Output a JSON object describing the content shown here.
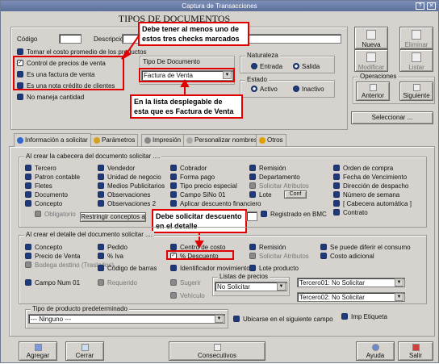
{
  "window": {
    "title": "Captura de Transacciones"
  },
  "header": {
    "doc_title": "TIPOS DE DOCUMENTOS"
  },
  "fields": {
    "codigo_label": "Código",
    "codigo_value": "",
    "descripcion_label": "Descripción",
    "descripcion_value": ""
  },
  "top_checks": [
    {
      "label": "Tomar el costo promedio de los productos",
      "checked": false
    },
    {
      "label": "Control de precios de venta",
      "checked": true
    },
    {
      "label": "Es una factura de venta",
      "checked": false
    },
    {
      "label": "Es una nota crédito de clientes",
      "checked": false
    },
    {
      "label": "No maneja cantidad",
      "checked": false
    }
  ],
  "tipo_documento": {
    "label": "Tipo De Documento",
    "selected": "Factura de Venta"
  },
  "naturaleza": {
    "label": "Naturaleza",
    "options": [
      "Entrada",
      "Salida"
    ],
    "selected": "Salida"
  },
  "estado": {
    "label": "Estado",
    "options": [
      "Activo",
      "Inactivo"
    ],
    "selected": "Activo"
  },
  "side_buttons": {
    "nueva": "Nueva",
    "eliminar": "Eliminar",
    "modificar": "Modificar",
    "listar": "Listar"
  },
  "operaciones": {
    "label": "Operaciones",
    "anterior": "Anterior",
    "siguiente": "Siguiente",
    "seleccionar": "Seleccionar ..."
  },
  "tabs": [
    "Información a solicitar",
    "Parámetros",
    "Impresión",
    "Personalizar nombres",
    "Otros"
  ],
  "cabecera": {
    "legend": "Al crear la cabecera del documento solicitar ....",
    "col1": [
      "Tercero",
      "Patron contable",
      "Fletes",
      "Documento",
      "Concepto"
    ],
    "col2": [
      "Vendedor",
      "Unidad de negocio",
      "Medios Publicitarios",
      "Observaciones",
      "Observaciones 2"
    ],
    "col3": [
      "Cobrador",
      "Forma pago",
      "Tipo precio especial",
      "Campo SiNo 01",
      "Aplicar descuento financiero"
    ],
    "col4": [
      "Remisión",
      "Departamento",
      "Solicitar Atributos",
      "Lote"
    ],
    "col5": [
      "Orden de compra",
      "Fecha de Vencimiento",
      "Dirección de despacho",
      "Número de semana",
      "[ Cabecera automática ]",
      "Contrato"
    ],
    "obligatorio": "Obligatorio",
    "restringir": "Restringir conceptos a",
    "conf": "Conf",
    "registrado_bmc": "Registrado en BMC"
  },
  "detalle": {
    "legend": "Al crear  el detalle del documento solicitar ....",
    "col1": [
      "Concepto",
      "Precio de Venta",
      "Bodega destino (Traslados)",
      "Campo Num 01"
    ],
    "col2": [
      "Pedido",
      "% Iva",
      "Código de barras",
      "Requerido"
    ],
    "col3": [
      "Centro de costo",
      "% Descuento",
      "Identificador movimiento",
      "Sugerir",
      "Vehículo"
    ],
    "col4": [
      "Remisión",
      "Solicitar Atributos",
      "Lote producto"
    ],
    "col5": [
      "Se puede diferir el consumo",
      "Costo adicional"
    ],
    "listas_label": "Listas de precios",
    "listas_selected": "No Solicitar",
    "tercero01": "Tercero01: No Solicitar",
    "tercero02": "Tercero02: No Solicitar"
  },
  "tipo_producto": {
    "label": "Tipo de producto predeterminado",
    "selected": "--- Ninguno ---",
    "ubicarse": "Ubicarse en el siguiente campo",
    "imp_etiqueta": "Imp Etiqueta"
  },
  "bottom_buttons": {
    "agregar": "Agregar",
    "cerrar": "Cerrar",
    "consecutivos": "Consecutivos",
    "ayuda": "Ayuda",
    "salir": "Salir"
  },
  "annotations": {
    "note1": "Debe tener al menos uno de estos tres checks marcados",
    "note2": "En la lista desplegable de esta que es Factura de Venta",
    "note3": "Debe solicitar descuento en el detalle"
  },
  "colors": {
    "annotation": "#e00000",
    "checkbox": "#1e3a7a",
    "window_bg": "#d6d3ce",
    "titlebar": "#6b7ea8"
  }
}
